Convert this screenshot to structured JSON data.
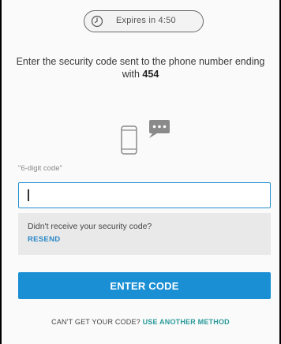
{
  "timer": {
    "text": "Expires in 4:50",
    "icon": "clock-icon"
  },
  "instruction": {
    "text": "Enter the security code sent to the phone number ending with ",
    "phone_suffix": "454"
  },
  "illustration": {
    "icon": "phone-message-icon"
  },
  "code_field": {
    "label": "\"6-digit code\"",
    "value": ""
  },
  "resend": {
    "question": "Didn't receive your security code?",
    "link": "RESEND"
  },
  "primary_button": {
    "label": "ENTER CODE"
  },
  "alternate": {
    "prefix": "CAN'T GET YOUR CODE? ",
    "link": "USE ANOTHER METHOD"
  },
  "colors": {
    "accent": "#1a8fd4",
    "link": "#2a87c6",
    "alt_link": "#2a9a9a",
    "panel_bg": "#fafafa",
    "resend_bg": "#e9e9e9"
  }
}
